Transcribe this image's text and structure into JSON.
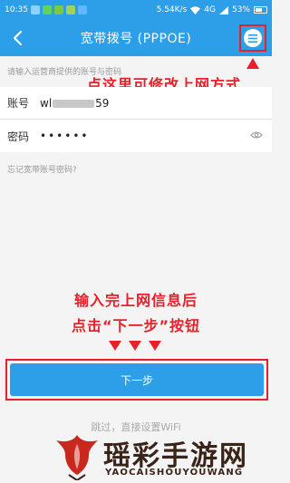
{
  "status_bar": {
    "time": "10:35",
    "speed": "5.54K/s",
    "network": "4G",
    "battery": "53%"
  },
  "header": {
    "title": "宽带拨号 (PPPOE)",
    "back_icon": "chevron-left-icon",
    "menu_icon": "menu-icon"
  },
  "form": {
    "hint": "请输入运营商提供的账号与密码",
    "account_label": "账号",
    "account_prefix": "wl",
    "account_suffix": "59",
    "password_label": "密码",
    "password_value": "••••••",
    "eye_icon": "eye-icon",
    "forgot_link": "忘记宽带账号密码?"
  },
  "annotations": {
    "top": "点这里可修改上网方式",
    "mid_line1": "输入完上网信息后",
    "mid_line2": "点击“下一步”按钮",
    "color": "#e8202a"
  },
  "actions": {
    "next_label": "下一步",
    "skip_label": "跳过，直接设置WiFi"
  },
  "watermark": {
    "name": "瑶彩手游网",
    "sub": "YAOCAISHOUYOUWANG"
  },
  "colors": {
    "primary": "#2d9fe9",
    "annotation_red": "#e8202a"
  }
}
